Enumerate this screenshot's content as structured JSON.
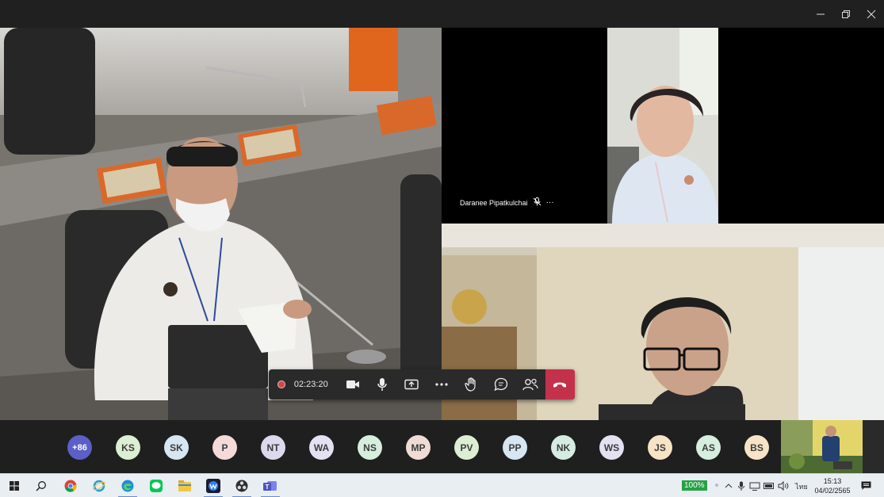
{
  "window": {
    "controls": [
      "minimize-icon",
      "restore-icon",
      "close-icon"
    ]
  },
  "participants_video": {
    "top_right_name": "Daranee Pipatkulchai",
    "top_right_more": "···"
  },
  "call_controls": {
    "recording_time": "02:23:20",
    "buttons": [
      "camera-icon",
      "microphone-icon",
      "share-screen-icon",
      "more-options-icon",
      "raise-hand-icon",
      "chat-icon",
      "participants-icon",
      "hang-up-icon"
    ]
  },
  "strip": {
    "avatars": [
      {
        "initials": "+86",
        "color": "#5b5fc7"
      },
      {
        "initials": "KS",
        "color": "#dcefd2"
      },
      {
        "initials": "SK",
        "color": "#d6e6f2"
      },
      {
        "initials": "P",
        "color": "#f6d9d9"
      },
      {
        "initials": "NT",
        "color": "#dcd9ef"
      },
      {
        "initials": "WA",
        "color": "#e4e1f3"
      },
      {
        "initials": "NS",
        "color": "#d6eedd"
      },
      {
        "initials": "MP",
        "color": "#f0dcd4"
      },
      {
        "initials": "PV",
        "color": "#dcefd2"
      },
      {
        "initials": "PP",
        "color": "#d6e6f2"
      },
      {
        "initials": "NK",
        "color": "#d5ece3"
      },
      {
        "initials": "WS",
        "color": "#e4e1f3"
      },
      {
        "initials": "JS",
        "color": "#f7e3c6"
      },
      {
        "initials": "AS",
        "color": "#d6eedd"
      },
      {
        "initials": "BS",
        "color": "#f7e3c6"
      }
    ]
  },
  "taskbar": {
    "apps": [
      "windows-start-icon",
      "search-icon",
      "chrome-icon",
      "internet-explorer-icon",
      "edge-icon",
      "line-icon",
      "file-explorer-icon",
      "webex-icon",
      "obs-icon",
      "teams-icon"
    ],
    "battery_percent": "100%",
    "language": "ไทย",
    "time": "15:13",
    "date": "04/02/2565"
  }
}
